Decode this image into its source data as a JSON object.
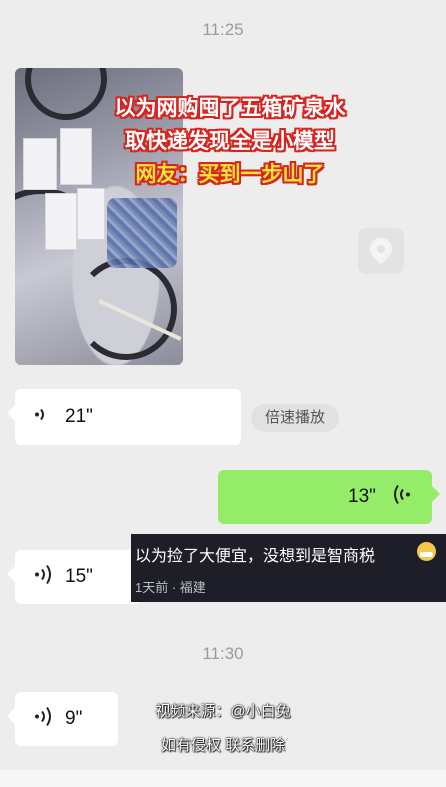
{
  "chat": {
    "timestamps": [
      "11:25",
      "11:30"
    ],
    "image_message": {
      "headline": [
        "以为网购囤了五箱矿泉水",
        "取快递发现全是小模型",
        "网友：买到一步山了"
      ]
    },
    "voice_messages": [
      {
        "direction": "incoming",
        "duration": "21\""
      },
      {
        "direction": "outgoing",
        "duration": "13\""
      },
      {
        "direction": "incoming",
        "duration": "15\""
      },
      {
        "direction": "incoming",
        "duration": "9\""
      }
    ],
    "speed_button": "倍速播放"
  },
  "comment_overlay": {
    "text": "以为捡了大便宜，没想到是智商税",
    "meta": "1天前 · 福建"
  },
  "watermark": {
    "source": "视频来源：@小白兔",
    "notice": "如有侵权  联系删除"
  },
  "colors": {
    "background": "#ededed",
    "incoming_bubble": "#ffffff",
    "outgoing_bubble": "#95ec69",
    "headline_stroke": "#d8241f",
    "headline_highlight": "#f8e437"
  }
}
